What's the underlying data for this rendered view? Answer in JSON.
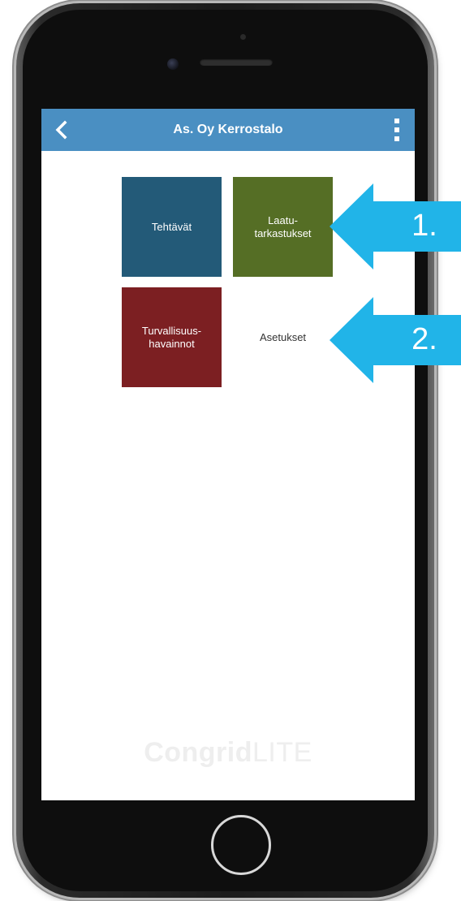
{
  "header": {
    "title": "As. Oy Kerrostalo",
    "color": "#4a8fc2"
  },
  "tiles": [
    {
      "label": "Tehtävät",
      "color": "#235a78"
    },
    {
      "label": "Laatu-\ntarkastukset",
      "color": "#556e25"
    },
    {
      "label": "Turvallisuus-\nhavainnot",
      "color": "#7c1f22"
    },
    {
      "label": "Asetukset",
      "color": "#ffffff"
    }
  ],
  "brand": {
    "strong": "Congrid",
    "light": "LITE"
  },
  "callouts": [
    {
      "label": "1.",
      "color": "#21b4e8"
    },
    {
      "label": "2.",
      "color": "#21b4e8"
    }
  ]
}
